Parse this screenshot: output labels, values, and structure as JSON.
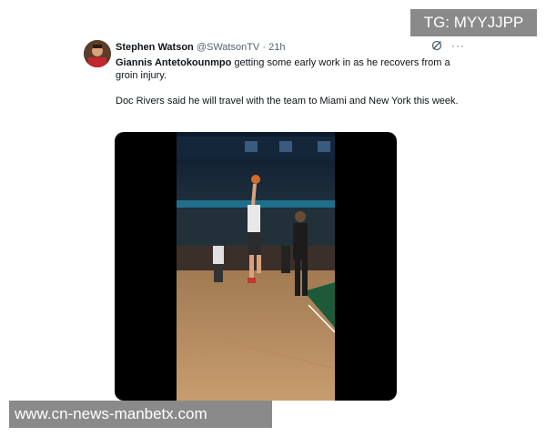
{
  "tweet": {
    "author_name": "Stephen Watson",
    "author_handle": "@SWatsonTV",
    "separator": "·",
    "time": "21h",
    "mention": "Giannis Antetokounmpo",
    "text_line1_rest": " getting some early work in as he recovers from a groin injury.",
    "text_line2": "Doc Rivers said he will travel with the team to Miami and New York this week.",
    "avatar_icon": "avatar-photo",
    "grok_icon": "grok-icon",
    "more_icon": "more-icon",
    "more_glyph": "···"
  },
  "media": {
    "type": "video",
    "description_icon": "basketball-court-video"
  },
  "watermarks": {
    "top": "TG: MYYJJPP",
    "bottom": "www.cn-news-manbetx.com"
  },
  "colors": {
    "name": "#0f1419",
    "muted": "#536471",
    "watermark_bg": "#8a8a8a"
  }
}
